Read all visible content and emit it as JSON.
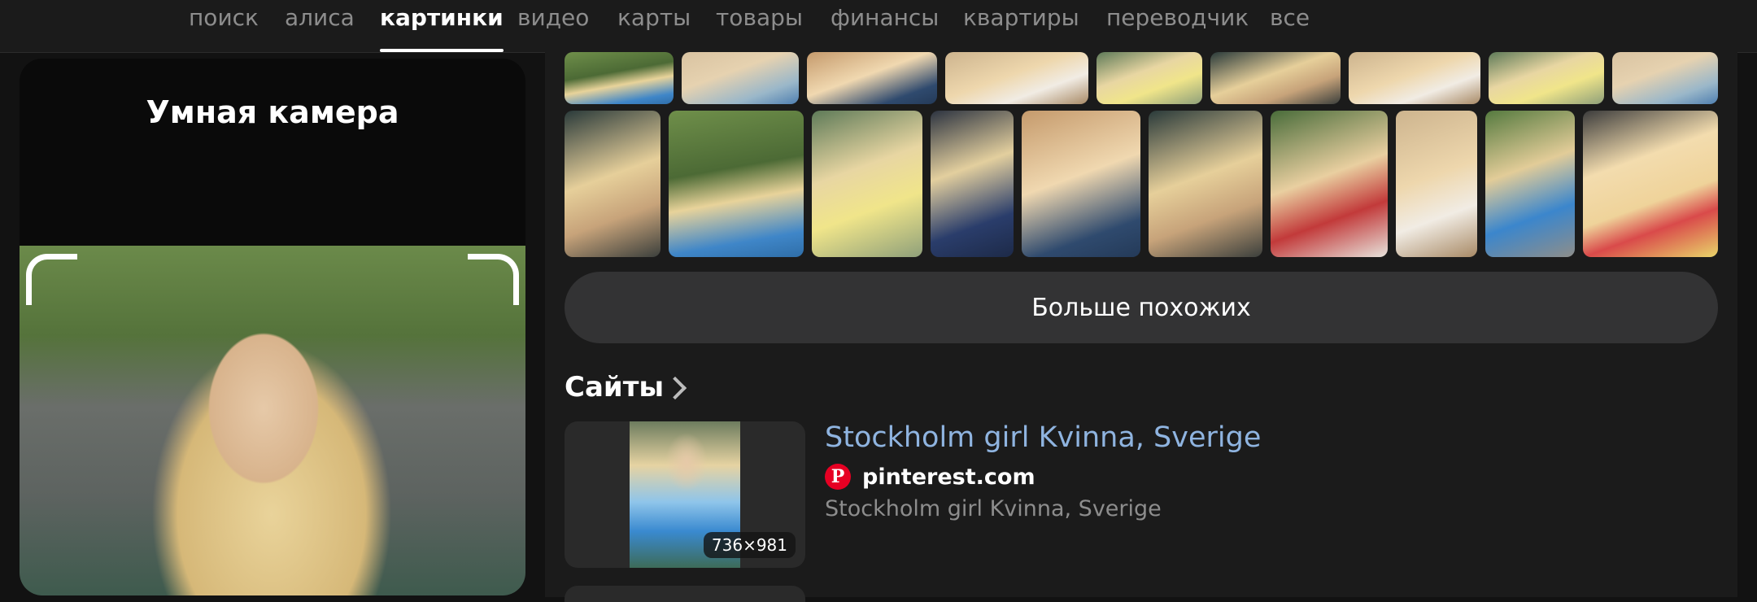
{
  "nav": {
    "tabs": [
      {
        "label": "поиск",
        "active": false
      },
      {
        "label": "алиса",
        "active": false
      },
      {
        "label": "картинки",
        "active": true
      },
      {
        "label": "видео",
        "active": false
      },
      {
        "label": "карты",
        "active": false
      },
      {
        "label": "товары",
        "active": false
      },
      {
        "label": "финансы",
        "active": false
      },
      {
        "label": "квартиры",
        "active": false
      },
      {
        "label": "переводчик",
        "active": false
      },
      {
        "label": "все",
        "active": false
      }
    ]
  },
  "camera": {
    "title": "Умная камера"
  },
  "similar": {
    "more_label": "Больше похожих"
  },
  "sites": {
    "heading": "Сайты",
    "items": [
      {
        "title": "Stockholm girl Kvinna, Sverige",
        "domain": "pinterest.com",
        "description": "Stockholm girl Kvinna, Sverige",
        "image_size": "736×981",
        "favicon_icon": "pinterest-icon"
      }
    ]
  },
  "colors": {
    "background": "#121212",
    "panel": "#1b1b1b",
    "link": "#8fb4e0",
    "pinterest": "#e60023"
  }
}
